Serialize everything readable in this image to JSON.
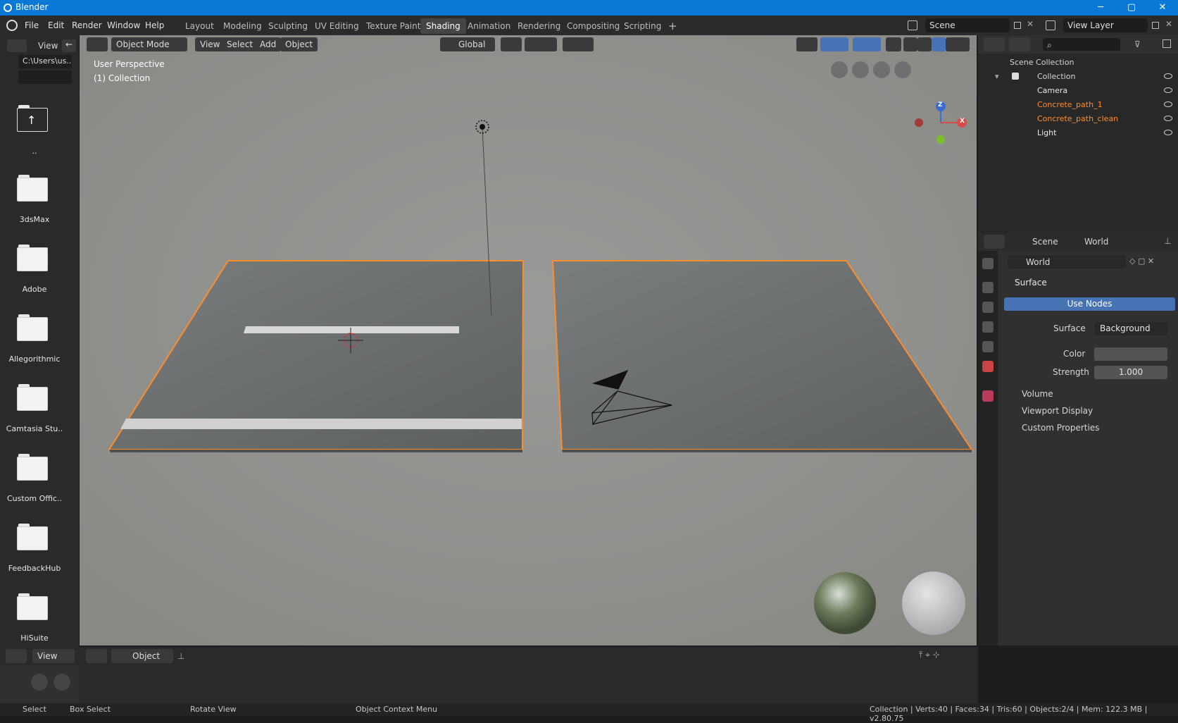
{
  "window": {
    "title": "Blender",
    "minimize": "─",
    "maximize": "▢",
    "close": "✕"
  },
  "menu": [
    "File",
    "Edit",
    "Render",
    "Window",
    "Help"
  ],
  "workspaces": [
    "Layout",
    "Modeling",
    "Sculpting",
    "UV Editing",
    "Texture Paint",
    "Shading",
    "Animation",
    "Rendering",
    "Compositing",
    "Scripting"
  ],
  "active_workspace": "Shading",
  "add_workspace": "+",
  "scene_field": "Scene",
  "view_layer_field": "View Layer",
  "file_browser": {
    "view_label": "View",
    "path": "C:\\Users\\us..",
    "items": [
      "..",
      "3dsMax",
      "Adobe",
      "Allegorithmic",
      "Camtasia Stu..",
      "Custom Offic..",
      "FeedbackHub",
      "HiSuite"
    ]
  },
  "viewport": {
    "mode": "Object Mode",
    "menus": [
      "View",
      "Select",
      "Add",
      "Object"
    ],
    "orientation": "Global",
    "overlay_text_1": "User Perspective",
    "overlay_text_2": "(1) Collection",
    "gizmo_axes": {
      "x": "X",
      "z": "Z"
    }
  },
  "outliner": {
    "root": "Scene Collection",
    "collection": "Collection",
    "items": [
      {
        "name": "Camera",
        "color": "#e8e8e8"
      },
      {
        "name": "Concrete_path_1",
        "color": "#ff8c2a"
      },
      {
        "name": "Concrete_path_clean",
        "color": "#ff8c2a"
      },
      {
        "name": "Light",
        "color": "#e8e8e8"
      }
    ]
  },
  "properties": {
    "breadcrumb": [
      "Scene",
      "World"
    ],
    "world_name": "World",
    "surface_panel": "Surface",
    "use_nodes": "Use Nodes",
    "surface_label": "Surface",
    "surface_value": "Background",
    "color_label": "Color",
    "strength_label": "Strength",
    "strength_value": "1.000",
    "panels": [
      "Volume",
      "Viewport Display",
      "Custom Properties"
    ]
  },
  "timeline": {
    "view_label": "View",
    "object_label": "Object"
  },
  "statusbar": {
    "select": "Select",
    "box_select": "Box Select",
    "rotate_view": "Rotate View",
    "context_menu": "Object Context Menu",
    "stats": "Collection | Verts:40 | Faces:34 | Tris:60 | Objects:2/4 | Mem: 122.3 MB | v2.80.75"
  },
  "colors": {
    "accent": "#4772b3",
    "selected_outline": "#ff8c2a",
    "titlebar": "#0a78d7"
  }
}
